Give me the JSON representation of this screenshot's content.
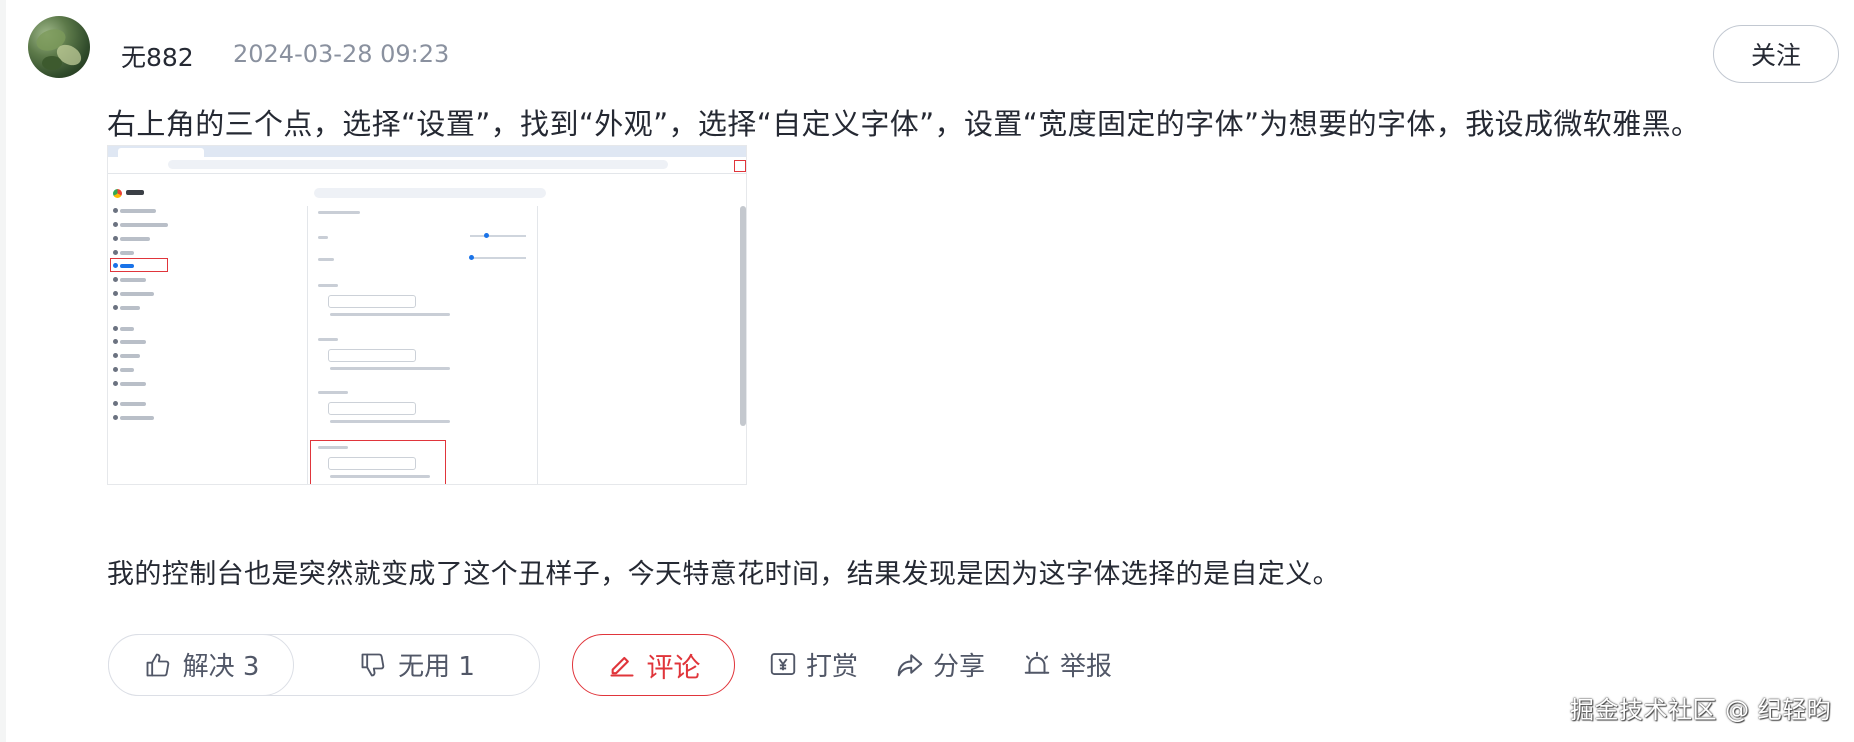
{
  "author": {
    "name": "无882",
    "timestamp": "2024-03-28 09:23",
    "follow_label": "关注"
  },
  "post": {
    "line1": "右上角的三个点，选择“设置”，找到“外观”，选择“自定义字体”，设置“宽度固定的字体”为想要的字体，我设成微软雅黑。",
    "line2": "我的控制台也是突然就变成了这个丑样子，今天特意花时间，结果发现是因为这字体选择的是自定义。",
    "image_icon": "browser-settings-screenshot"
  },
  "actions": {
    "solved_label": "解决 3",
    "useless_label": "无用 1",
    "comment_label": "评论",
    "reward_label": "打赏",
    "share_label": "分享",
    "report_label": "举报"
  },
  "watermark": "掘金技术社区 @ 纪轻昀",
  "colors": {
    "accent_red": "#e0353b",
    "text_primary": "#252933",
    "text_secondary": "#8a919f",
    "action_text": "#515767"
  }
}
